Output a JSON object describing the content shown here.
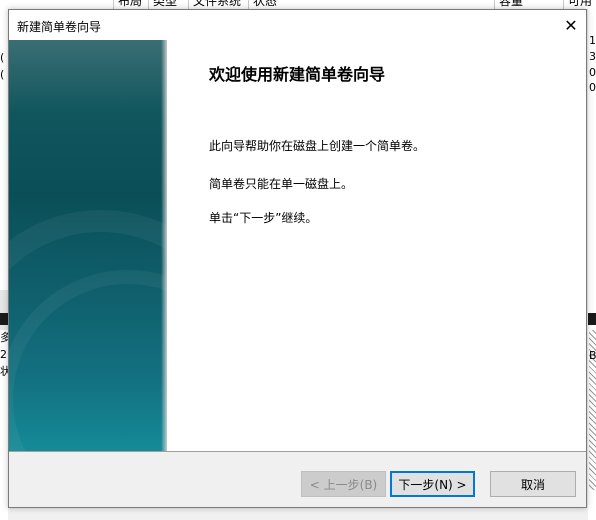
{
  "background_window": {
    "columns": [
      "布局",
      "类型",
      "文件系统",
      "状态",
      "容量",
      "可用"
    ],
    "right_fragments": [
      "1",
      "3",
      "0",
      "0",
      "B"
    ],
    "left_fragments": [
      "(",
      "(",
      "多",
      "2",
      "状"
    ]
  },
  "dialog": {
    "title": "新建简单卷向导",
    "close_glyph": "✕",
    "heading": "欢迎使用新建简单卷向导",
    "paragraphs": [
      "此向导帮助你在磁盘上创建一个简单卷。",
      "简单卷只能在单一磁盘上。",
      "单击“下一步”继续。"
    ],
    "buttons": {
      "back": "< 上一步(B)",
      "next": "下一步(N) >",
      "cancel": "取消"
    }
  }
}
